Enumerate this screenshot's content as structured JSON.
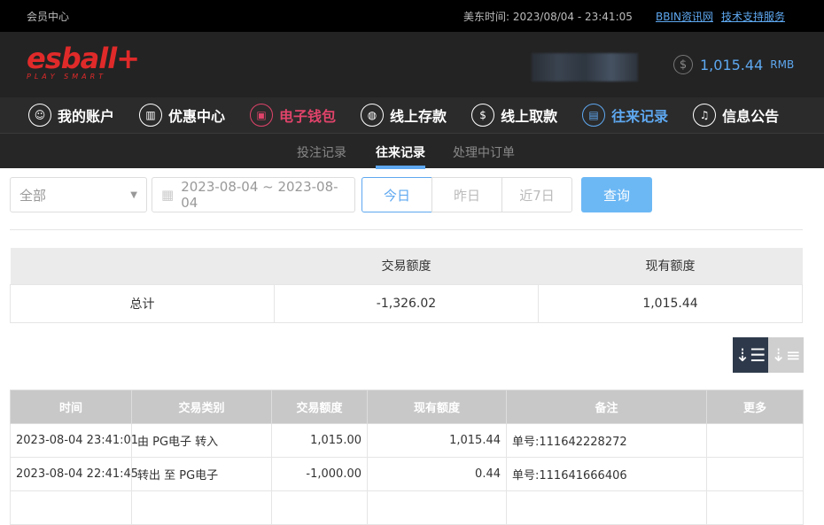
{
  "topbar": {
    "title": "会员中心",
    "time_label": "美东时间: 2023/08/04 - 23:41:05",
    "link1": "BBIN资讯网",
    "link2": "技术支持服务"
  },
  "header": {
    "logo": "esball+",
    "logo_sub": "PLAY SMART",
    "balance": "1,015.44",
    "currency": "RMB",
    "coin_icon": "$"
  },
  "nav": [
    {
      "label": "我的账户",
      "icon": "user"
    },
    {
      "label": "优惠中心",
      "icon": "gift"
    },
    {
      "label": "电子钱包",
      "icon": "wallet"
    },
    {
      "label": "线上存款",
      "icon": "deposit"
    },
    {
      "label": "线上取款",
      "icon": "withdraw"
    },
    {
      "label": "往来记录",
      "icon": "records"
    },
    {
      "label": "信息公告",
      "icon": "bell"
    }
  ],
  "subnav": [
    "投注记录",
    "往来记录",
    "处理中订单"
  ],
  "filters": {
    "type": "全部",
    "date_range": "2023-08-04 ~ 2023-08-04",
    "today": "今日",
    "yesterday": "昨日",
    "last7": "近7日",
    "query": "查询"
  },
  "summary": {
    "headers": [
      "",
      "交易额度",
      "现有额度"
    ],
    "label": "总计",
    "amount": "-1,326.02",
    "balance": "1,015.44"
  },
  "records": {
    "headers": [
      "时间",
      "交易类别",
      "交易额度",
      "现有额度",
      "备注",
      "更多"
    ],
    "rows": [
      [
        "2023-08-04 23:41:01",
        "由 PG电子 转入",
        "1,015.00",
        "1,015.44",
        "单号:111642228272",
        ""
      ],
      [
        "2023-08-04 22:41:45",
        "转出 至 PG电子",
        "-1,000.00",
        "0.44",
        "单号:111641666406",
        ""
      ]
    ]
  }
}
